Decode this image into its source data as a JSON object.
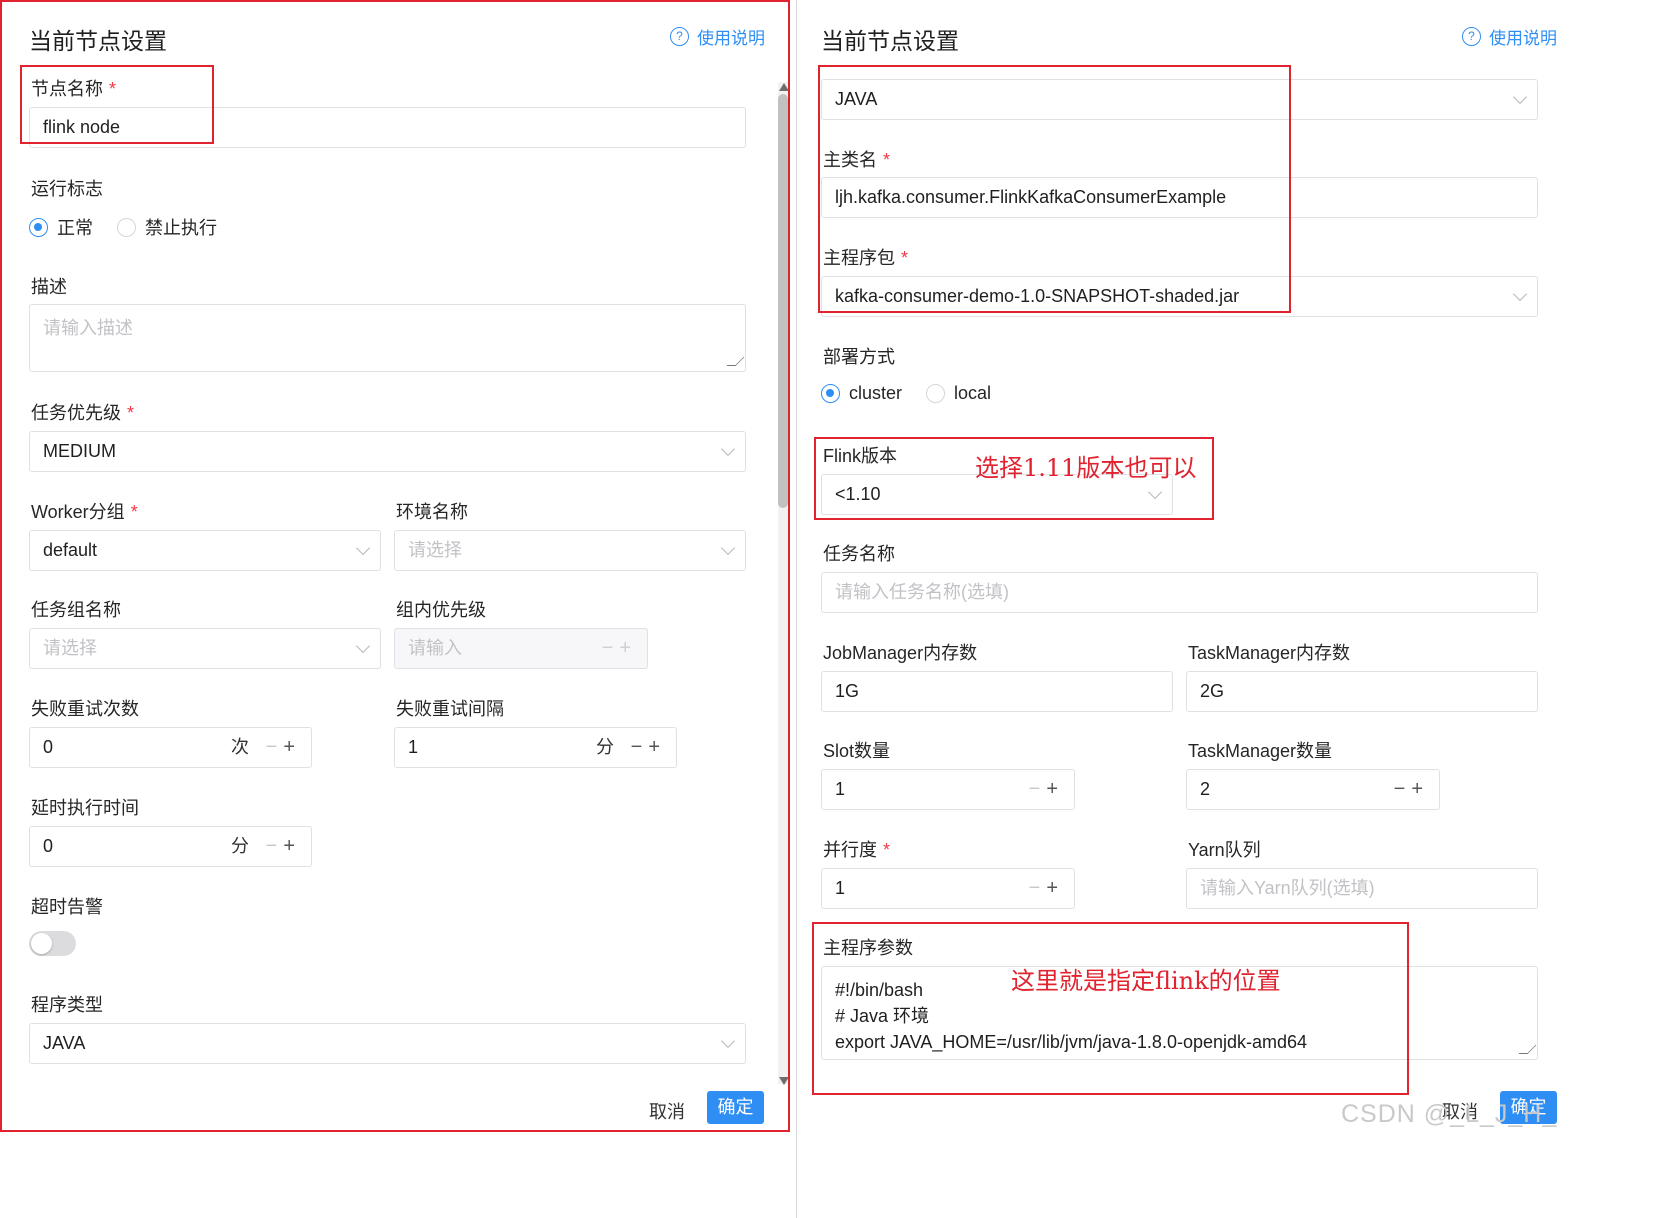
{
  "left": {
    "title": "当前节点设置",
    "help": "使用说明",
    "node_name": {
      "label": "节点名称",
      "value": "flink node"
    },
    "run_flag": {
      "label": "运行标志",
      "options": [
        "正常",
        "禁止执行"
      ],
      "selected": "正常"
    },
    "description": {
      "label": "描述",
      "placeholder": "请输入描述"
    },
    "priority": {
      "label": "任务优先级",
      "value": "MEDIUM"
    },
    "worker_group": {
      "label": "Worker分组",
      "value": "default"
    },
    "env_name": {
      "label": "环境名称",
      "placeholder": "请选择"
    },
    "task_group": {
      "label": "任务组名称",
      "placeholder": "请选择"
    },
    "group_priority": {
      "label": "组内优先级",
      "placeholder": "请输入"
    },
    "retry_times": {
      "label": "失败重试次数",
      "value": "0",
      "unit": "次"
    },
    "retry_interval": {
      "label": "失败重试间隔",
      "value": "1",
      "unit": "分"
    },
    "delay_time": {
      "label": "延时执行时间",
      "value": "0",
      "unit": "分"
    },
    "timeout_alarm": {
      "label": "超时告警",
      "enabled": false
    },
    "program_type": {
      "label": "程序类型",
      "value": "JAVA"
    },
    "cancel": "取消",
    "confirm": "确定"
  },
  "right": {
    "title": "当前节点设置",
    "help": "使用说明",
    "program_type_value": "JAVA",
    "main_class": {
      "label": "主类名",
      "value": "ljh.kafka.consumer.FlinkKafkaConsumerExample"
    },
    "main_package": {
      "label": "主程序包",
      "value": "kafka-consumer-demo-1.0-SNAPSHOT-shaded.jar"
    },
    "deploy_mode": {
      "label": "部署方式",
      "options": [
        "cluster",
        "local"
      ],
      "selected": "cluster"
    },
    "flink_version": {
      "label": "Flink版本",
      "value": "<1.10"
    },
    "task_name": {
      "label": "任务名称",
      "placeholder": "请输入任务名称(选填)"
    },
    "jobmanager_memory": {
      "label": "JobManager内存数",
      "value": "1G"
    },
    "taskmanager_memory": {
      "label": "TaskManager内存数",
      "value": "2G"
    },
    "slot_count": {
      "label": "Slot数量",
      "value": "1"
    },
    "taskmanager_count": {
      "label": "TaskManager数量",
      "value": "2"
    },
    "parallelism": {
      "label": "并行度",
      "value": "1"
    },
    "yarn_queue": {
      "label": "Yarn队列",
      "placeholder": "请输入Yarn队列(选填)"
    },
    "main_args": {
      "label": "主程序参数",
      "lines": [
        "#!/bin/bash",
        "# Java 环境",
        "export JAVA_HOME=/usr/lib/jvm/java-1.8.0-openjdk-amd64"
      ]
    },
    "cancel": "取消",
    "confirm": "确定"
  },
  "annotations": {
    "flink_version_note": "选择1.11版本也可以",
    "main_args_note": "这里就是指定flink的位置"
  },
  "watermark": "CSDN @_L_J_H_",
  "colors": {
    "accent": "#2f8ef4",
    "required": "#f0374a",
    "annotation": "#e0232f"
  }
}
